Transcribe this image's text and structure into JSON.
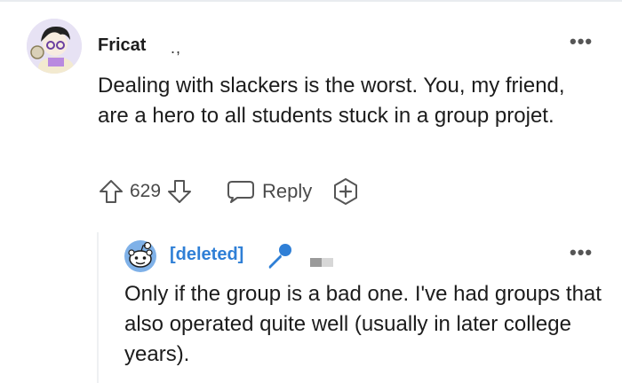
{
  "comment": {
    "username": "Fricat",
    "marker": ".,",
    "text": "Dealing with slackers is the worst. You, my friend, are a hero to all students stuck in a group projet.",
    "votes": "629",
    "reply_label": "Reply",
    "more_label": "•••"
  },
  "reply": {
    "username": "[deleted]",
    "text": "Only if the group is a bad one. I've had groups that also operated quite well (usually in later college years).",
    "more_label": "•••"
  },
  "colors": {
    "deleted_user": "#2f7fd6",
    "text": "#1c1c1c",
    "muted": "#4a4a4a"
  }
}
